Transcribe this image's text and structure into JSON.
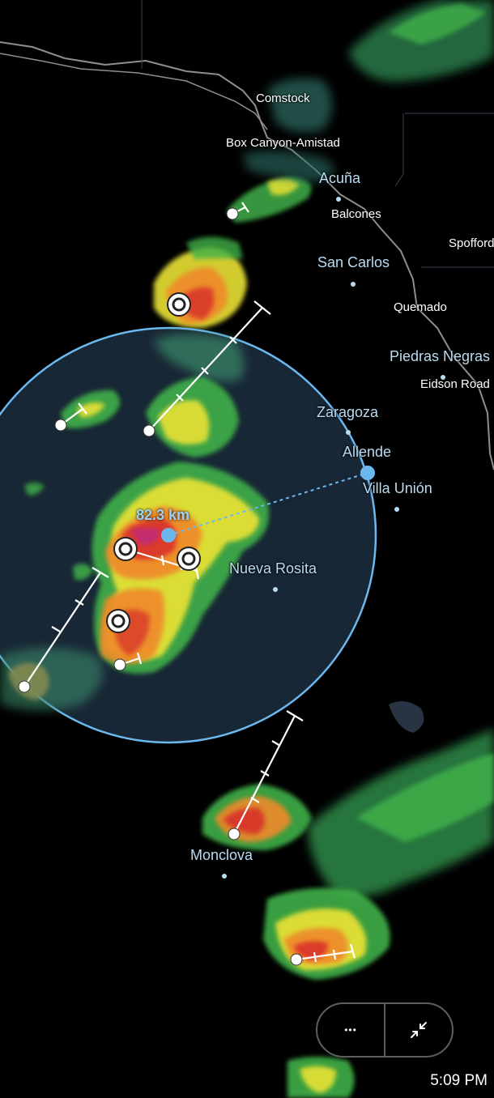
{
  "map": {
    "cities": [
      {
        "name": "Comstock",
        "style": "white"
      },
      {
        "name": "Box Canyon-Amistad",
        "style": "white"
      },
      {
        "name": "Acuña",
        "style": "blue"
      },
      {
        "name": "Balcones",
        "style": "white"
      },
      {
        "name": "Spofford",
        "style": "white"
      },
      {
        "name": "San Carlos",
        "style": "blue"
      },
      {
        "name": "Quemado",
        "style": "white"
      },
      {
        "name": "Piedras Negras",
        "style": "blue"
      },
      {
        "name": "Eidson Road",
        "style": "white"
      },
      {
        "name": "Zaragoza",
        "style": "blue"
      },
      {
        "name": "Allende",
        "style": "blue"
      },
      {
        "name": "Villa Unión",
        "style": "blue"
      },
      {
        "name": "Nueva Rosita",
        "style": "blue"
      },
      {
        "name": "Monclova",
        "style": "blue"
      }
    ],
    "measure": {
      "distance_label": "82.3 km",
      "color": "#6bb8ef"
    },
    "colors": {
      "circle_fill": "#1a2a3a",
      "circle_stroke": "#6bb8ef",
      "border": "#9a9a9a",
      "radar_light": "#3a8a6a",
      "radar_green": "#3fb04a",
      "radar_yellow": "#e9e236",
      "radar_orange": "#ef8a2a",
      "radar_red": "#d8302a",
      "radar_magenta": "#c02a7a"
    }
  },
  "controls": {
    "more_icon": "more-dots-icon",
    "more_label": "•••",
    "collapse_icon": "collapse-arrows-icon"
  },
  "status": {
    "time": "5:09 PM"
  }
}
